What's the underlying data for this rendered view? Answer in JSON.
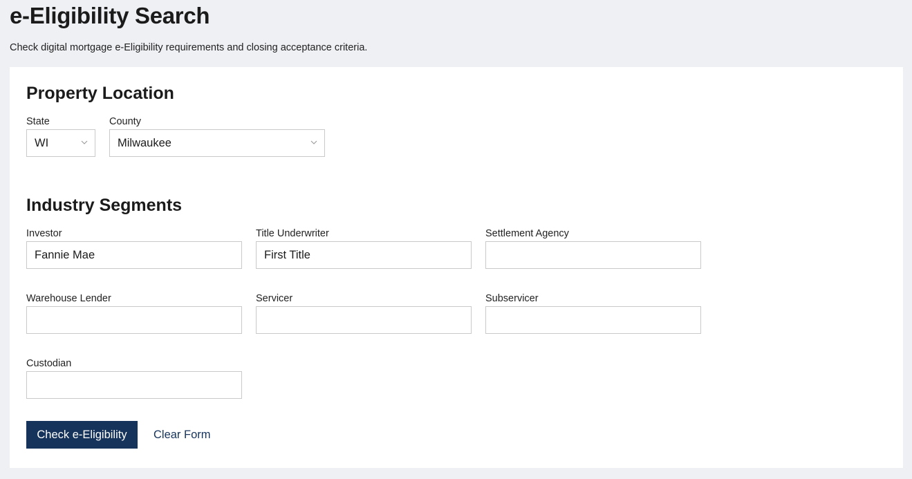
{
  "header": {
    "title": "e-Eligibility Search",
    "subtitle": "Check digital mortgage e-Eligibility requirements and closing acceptance criteria."
  },
  "property_location": {
    "title": "Property Location",
    "state": {
      "label": "State",
      "value": "WI",
      "icon": "chevron-down-icon"
    },
    "county": {
      "label": "County",
      "value": "Milwaukee",
      "icon": "chevron-down-icon"
    }
  },
  "industry_segments": {
    "title": "Industry Segments",
    "investor": {
      "label": "Investor",
      "value": "Fannie Mae"
    },
    "title_underwriter": {
      "label": "Title Underwriter",
      "value": "First Title"
    },
    "settlement_agency": {
      "label": "Settlement Agency",
      "value": ""
    },
    "warehouse_lender": {
      "label": "Warehouse Lender",
      "value": ""
    },
    "servicer": {
      "label": "Servicer",
      "value": ""
    },
    "subservicer": {
      "label": "Subservicer",
      "value": ""
    },
    "custodian": {
      "label": "Custodian",
      "value": ""
    }
  },
  "actions": {
    "check_label": "Check e-Eligibility",
    "clear_label": "Clear Form"
  },
  "colors": {
    "primary": "#15335b",
    "page_background": "#eff0f4",
    "card_background": "#ffffff",
    "border": "#c9c9c9"
  }
}
